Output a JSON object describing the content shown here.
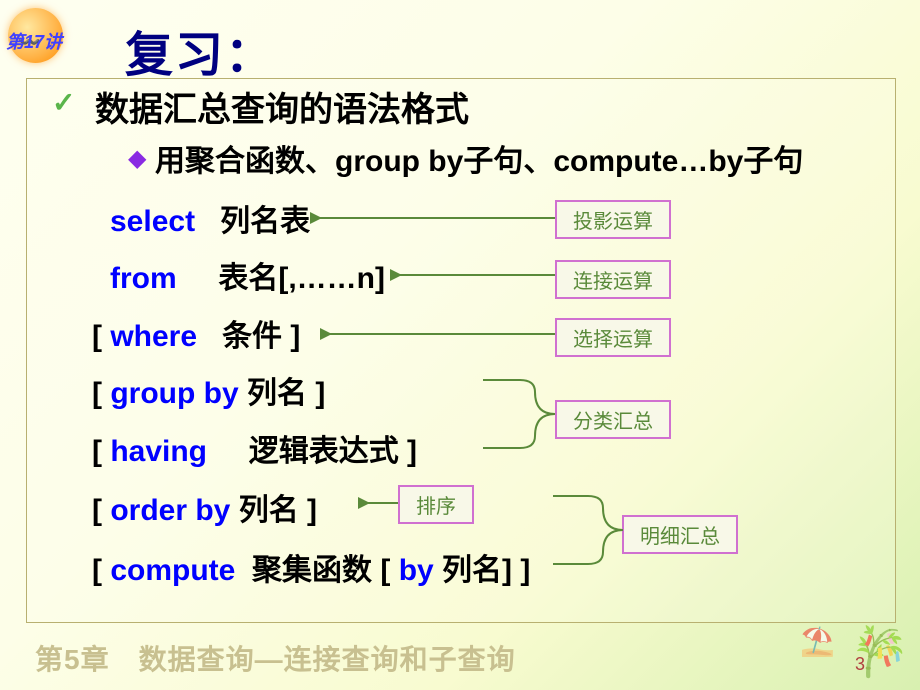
{
  "lesson_tag": "第17讲",
  "title": "复习：",
  "heading": "数据汇总查询的语法格式",
  "subtitle": "用聚合函数、group by子句、compute…by子句",
  "syntax": {
    "select": {
      "kw": "select",
      "arg": "列名表"
    },
    "from": {
      "kw": "from",
      "arg": "表名[,……n]"
    },
    "where": {
      "lb": "[ ",
      "kw": "where",
      "arg": "条件 ]"
    },
    "group": {
      "lb": "[ ",
      "kw": "group  by",
      "arg": "列名  ]"
    },
    "having": {
      "lb": "[ ",
      "kw": "having",
      "arg": "逻辑表达式 ]"
    },
    "order": {
      "lb": "[ ",
      "kw": "order  by",
      "arg": "列名  ]"
    },
    "compute": {
      "lb": "[ ",
      "kw": "compute",
      "arg": "聚集函数  [ ",
      "kw2": "by",
      "arg2": " 列名]  ]"
    }
  },
  "labels": {
    "projection": "投影运算",
    "join": "连接运算",
    "selection": "选择运算",
    "group_agg": "分类汇总",
    "sort": "排序",
    "detail_agg": "明细汇总"
  },
  "footer_chapter": "第5章　数据查询—连接查询和子查询",
  "page_number": "3"
}
